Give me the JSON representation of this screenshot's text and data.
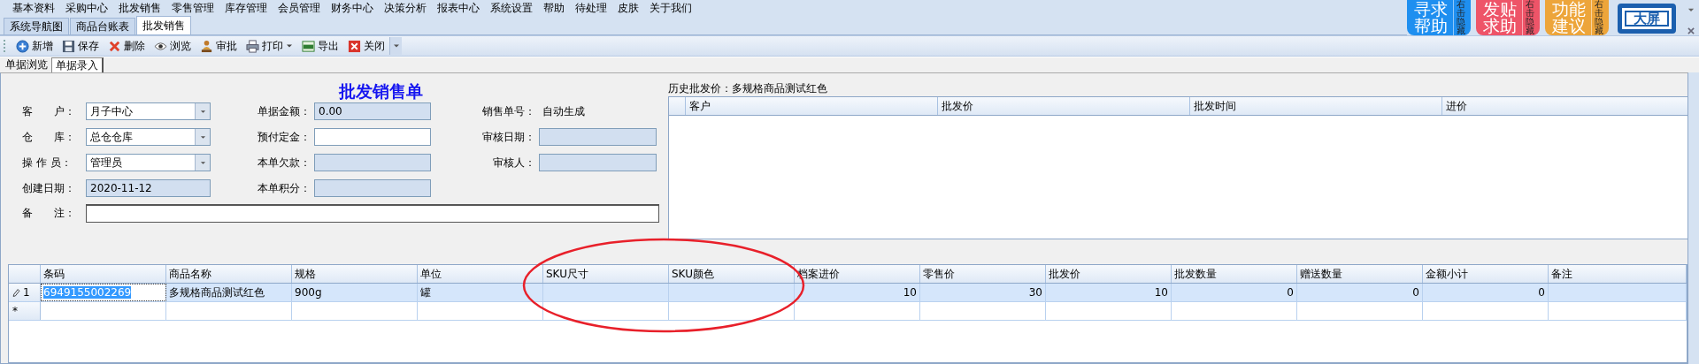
{
  "menu": [
    "基本资料",
    "采购中心",
    "批发销售",
    "零售管理",
    "库存管理",
    "会员管理",
    "财务中心",
    "决策分析",
    "报表中心",
    "系统设置",
    "帮助",
    "待处理",
    "皮肤",
    "关于我们"
  ],
  "help_buttons": [
    {
      "label": "寻求帮助",
      "hint": "右击隐藏",
      "color": "#1e8ff0"
    },
    {
      "label": "发贴求助",
      "hint": "右击隐藏",
      "color": "#ee5468"
    },
    {
      "label": "功能建议",
      "hint": "右击隐藏",
      "color": "#eda53a"
    }
  ],
  "big_screen": {
    "label": "大屏"
  },
  "doc_tabs": [
    {
      "label": "系统导航图",
      "selected": false
    },
    {
      "label": "商品台账表",
      "selected": false
    },
    {
      "label": "批发销售",
      "selected": true
    }
  ],
  "toolbar": [
    {
      "label": "新增",
      "kind": "add"
    },
    {
      "label": "保存",
      "kind": "save"
    },
    {
      "label": "删除",
      "kind": "delete"
    },
    {
      "label": "浏览",
      "kind": "view"
    },
    {
      "label": "审批",
      "kind": "approve"
    },
    {
      "label": "打印",
      "kind": "print",
      "dropdown": true
    },
    {
      "label": "导出",
      "kind": "export"
    },
    {
      "label": "关闭",
      "kind": "close"
    }
  ],
  "sub_tabs": [
    {
      "label": "单据浏览",
      "selected": false
    },
    {
      "label": "单据录入",
      "selected": true
    }
  ],
  "form": {
    "title": "批发销售单",
    "rows": [
      [
        {
          "label": "客　　户：",
          "kind": "combo",
          "value": "月子中心"
        },
        {
          "label": "单据金额：",
          "kind": "readonly",
          "value": "0.00"
        },
        {
          "label": "销售单号：",
          "kind": "text",
          "value": "自动生成"
        }
      ],
      [
        {
          "label": "仓　　库：",
          "kind": "combo",
          "value": "总仓仓库"
        },
        {
          "label": "预付定金：",
          "kind": "input"
        },
        {
          "label": "审核日期：",
          "kind": "readonly"
        }
      ],
      [
        {
          "label": "操 作 员：",
          "kind": "combo",
          "value": "管理员"
        },
        {
          "label": "本单欠款：",
          "kind": "readonly"
        },
        {
          "label": "审核人：",
          "kind": "readonly"
        }
      ],
      [
        {
          "label": "创建日期：",
          "kind": "readonly",
          "value": "2020-11-12"
        },
        {
          "label": "本单积分：",
          "kind": "readonly"
        }
      ]
    ],
    "remark": {
      "label": "备　　注："
    }
  },
  "history": {
    "title": "历史批发价：多规格商品测试红色",
    "columns": [
      "客户",
      "批发价",
      "批发时间",
      "进价"
    ]
  },
  "grid": {
    "columns": [
      {
        "label": "条码"
      },
      {
        "label": "商品名称"
      },
      {
        "label": "规格"
      },
      {
        "label": "单位"
      },
      {
        "label": "SKU尺寸"
      },
      {
        "label": "SKU颜色"
      },
      {
        "label": "档案进价",
        "numeric": true
      },
      {
        "label": "零售价",
        "numeric": true
      },
      {
        "label": "批发价",
        "numeric": true
      },
      {
        "label": "批发数量",
        "numeric": true
      },
      {
        "label": "赠送数量",
        "numeric": true
      },
      {
        "label": "金额小计",
        "numeric": true
      },
      {
        "label": "备注"
      }
    ],
    "rows": [
      {
        "kind": "editing",
        "marker": "1",
        "selected": true,
        "cells": [
          {
            "text": "6949155002269",
            "focused": true
          },
          "多规格商品测试红色",
          "900g",
          "罐",
          null,
          null,
          "10",
          "30",
          "10",
          "0",
          "0",
          "0",
          null
        ]
      },
      {
        "kind": "new",
        "marker": "*",
        "selected": false,
        "cells": [
          null,
          null,
          null,
          null,
          null,
          null,
          null,
          null,
          null,
          null,
          null,
          null,
          null
        ]
      }
    ]
  },
  "annotation": {
    "kind": "ellipse"
  }
}
